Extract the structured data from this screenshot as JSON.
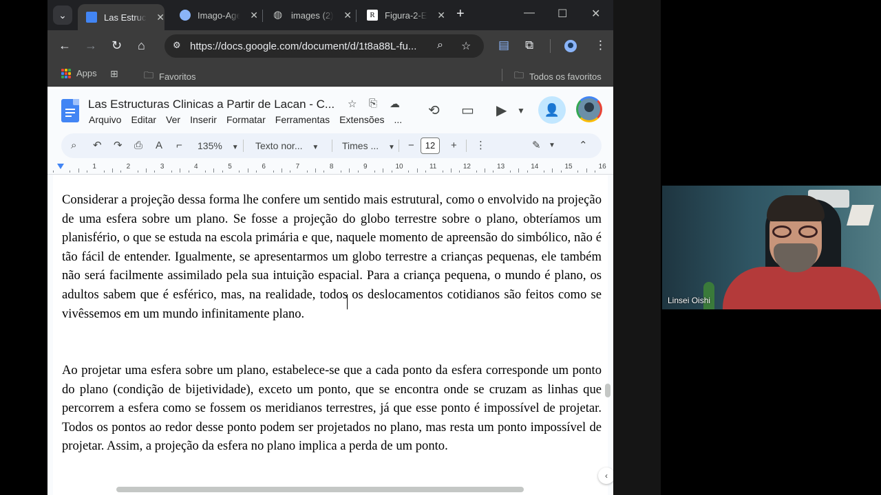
{
  "browser": {
    "tabs": [
      {
        "title": "Las Estructuras Clinicas a Partir de Lacan",
        "active": true,
        "favicon": "docs-icon"
      },
      {
        "title": "Imago-Agenda",
        "active": false,
        "favicon": "docs-icon"
      },
      {
        "title": "images (2)",
        "active": false,
        "favicon": "globe-icon"
      },
      {
        "title": "Figura-2-E",
        "active": false,
        "favicon": "researchgate-icon"
      }
    ],
    "url": "https://docs.google.com/document/d/1t8a88L-fu...",
    "bookmarks": {
      "apps": "Apps",
      "favoritos": "Favoritos",
      "todos": "Todos os favoritos"
    }
  },
  "docs": {
    "title": "Las Estructuras Clinicas a Partir de Lacan - C...",
    "menus": [
      "Arquivo",
      "Editar",
      "Ver",
      "Inserir",
      "Formatar",
      "Ferramentas",
      "Extensões",
      "..."
    ],
    "toolbar": {
      "zoom": "135%",
      "style": "Texto nor...",
      "font": "Times ...",
      "font_size": "12"
    },
    "ruler_numbers": [
      "1",
      "2",
      "3",
      "4",
      "5",
      "6",
      "7",
      "8",
      "9",
      "10",
      "11",
      "12",
      "13",
      "14",
      "15",
      "16"
    ],
    "paragraphs": [
      "Considerar a projeção dessa forma lhe confere um sentido mais estrutural, como o envolvido na projeção de uma esfera sobre um plano. Se fosse a projeção do globo terrestre sobre o plano, obteríamos um planisfério, o que se estuda na escola primária e que, naquele momento de apreensão do simbólico, não é tão fácil de entender. Igualmente, se apresentarmos um globo terrestre a crianças pequenas, ele também não será facilmente assimilado pela sua intuição espacial. Para a criança pequena, o mundo é plano, os adultos sabem que é esférico, mas, na realidade, todos os deslocamentos cotidianos são feitos como se vivêssemos em um mundo infinitamente plano.",
      "Ao projetar uma esfera sobre um plano, estabelece-se que a cada ponto da esfera corresponde um ponto do plano (condição de bijetividade), exceto um ponto, que se encontra onde se cruzam as linhas que percorrem a esfera como se fossem os meridianos terrestres, já que esse ponto é impossível de projetar. Todos os pontos ao redor desse ponto podem ser projetados no plano, mas resta um ponto impossível de projetar. Assim, a projeção da esfera no plano implica a perda de um ponto."
    ]
  },
  "video": {
    "participant_name": "Linsei Oishi"
  },
  "colors": {
    "docs_blue": "#4285f4",
    "tab_strip": "#202124",
    "toolbar": "#3c3c3c",
    "share_button": "#c2e7ff"
  }
}
